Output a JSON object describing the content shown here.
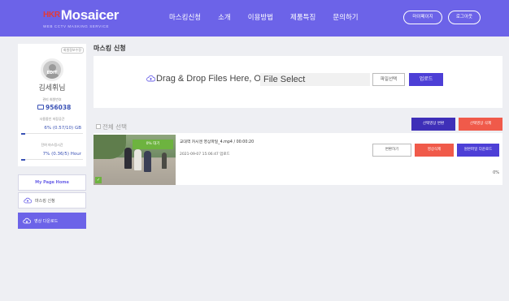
{
  "header": {
    "logo_prefix": "HKR",
    "logo_main": "Mosaicer",
    "logo_sub": "WEB CCTV MASKING SERVICE",
    "nav": [
      "마스킹신청",
      "소개",
      "이용방법",
      "제품특징",
      "문의하기"
    ],
    "mypage_label": "마이페이지",
    "logout_label": "로그아웃"
  },
  "profile": {
    "edit_chip": "회원정보수정",
    "avatar_text": "EDIT",
    "name": "김세휘님",
    "id_label": "관리 회원번호",
    "id_value": "956038",
    "usage_label": "사용중인 저장공간",
    "usage_value": "6% (0.57/10) GB",
    "usage_fraction": 0.06,
    "time_label": "잔여 마스킹시간",
    "time_value": "7% (0.36/5) Hour",
    "time_fraction": 0.07
  },
  "sidebar": {
    "home_label": "My Page Home",
    "request_label": "마스킹 신청",
    "download_label": "영상 다운로드"
  },
  "main": {
    "title": "마스킹 신청",
    "dropzone_text": "Drag & Drop Files Here, Or",
    "file_field_value": "File Select",
    "select_button": "파일선택",
    "upload_button": "업로드",
    "select_all_label": "전체 선택",
    "convert_selected_button": "선택영상 변환",
    "delete_selected_button": "선택영상 삭제"
  },
  "video": {
    "percent_badge": "0% 대기",
    "check_badge": "✓",
    "filename": "교대역 카시엔 영상파일_4.mp4 / 00:00:20",
    "upload_date": "2021-09-07 15:06:47 업로드",
    "rename_button": "변환하기",
    "delete_button": "영상삭제",
    "download_button": "원본파일 다운로드",
    "progress_text": "0%"
  },
  "colors": {
    "header": "#6c63e8",
    "accent": "#4d3fd6",
    "danger": "#f05a4a",
    "id_blue": "#3a52b5"
  }
}
